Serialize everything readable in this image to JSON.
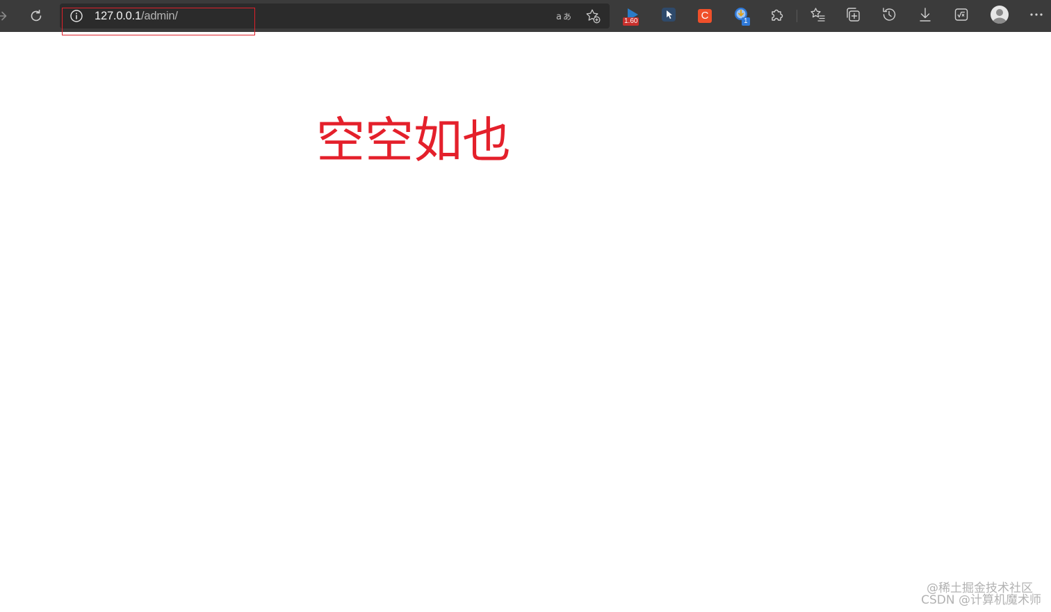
{
  "browser": {
    "address": {
      "host": "127.0.0.1",
      "path": "/admin/"
    },
    "extensions": {
      "video_speed_badge": "1.60",
      "notification_count": "1",
      "c_extension_letter": "C"
    }
  },
  "page": {
    "heading": "空空如也"
  },
  "watermark": {
    "line1": "@稀土掘金技术社区",
    "line2": "CSDN @计算机魔术师"
  },
  "colors": {
    "toolbar_bg": "#3b3b3b",
    "addressbar_bg": "#2b2b2b",
    "heading_red": "#e4202b",
    "highlight_red": "#e0202a",
    "icon_gray": "#d0d0d0"
  },
  "icons": {
    "nav": [
      "forward-arrow-icon",
      "refresh-icon"
    ],
    "address": [
      "site-info-icon",
      "read-aloud-icon",
      "add-favorite-icon"
    ],
    "toolbar": [
      "video-speed-extension-icon",
      "cursor-extension-icon",
      "c-extension-icon",
      "download-helper-extension-icon",
      "extensions-puzzle-icon",
      "favorites-icon",
      "collections-icon",
      "history-icon",
      "downloads-icon",
      "math-solver-icon",
      "profile-avatar-icon",
      "more-menu-icon"
    ]
  }
}
